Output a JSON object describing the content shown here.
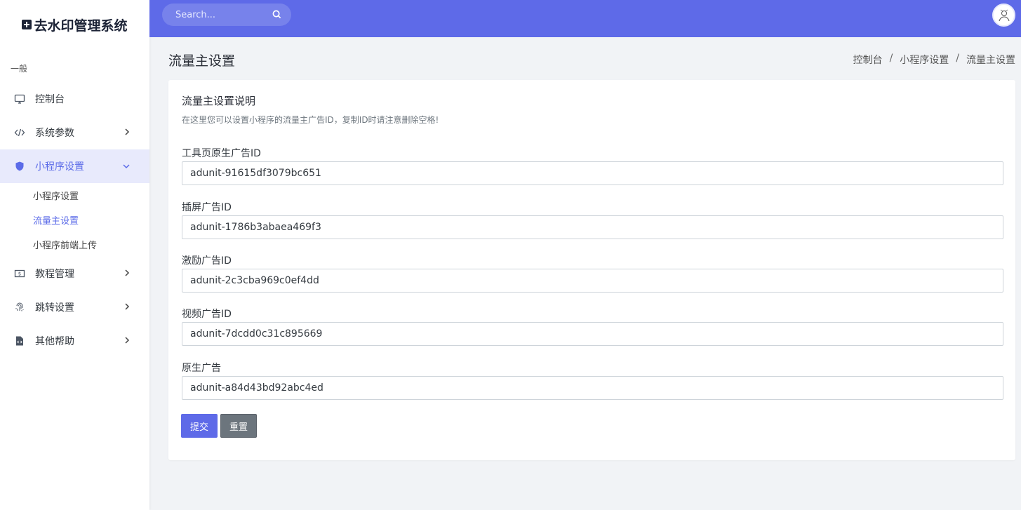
{
  "app": {
    "logo_text": "去水印管理系统"
  },
  "sidebar": {
    "section_title": "一般",
    "items": [
      {
        "label": "控制台",
        "icon": "monitor-icon"
      },
      {
        "label": "系统参数",
        "icon": "code-icon"
      },
      {
        "label": "小程序设置",
        "icon": "shield-icon"
      },
      {
        "label": "教程管理",
        "icon": "dollar-bill-icon"
      },
      {
        "label": "跳转设置",
        "icon": "fingerprint-icon"
      },
      {
        "label": "其他帮助",
        "icon": "file-code-icon"
      }
    ],
    "subitems": [
      {
        "label": "小程序设置"
      },
      {
        "label": "流量主设置"
      },
      {
        "label": "小程序前端上传"
      }
    ]
  },
  "topbar": {
    "search_placeholder": "Search..."
  },
  "page": {
    "title": "流量主设置",
    "breadcrumb": [
      "控制台",
      "小程序设置",
      "流量主设置"
    ]
  },
  "card": {
    "title": "流量主设置说明",
    "description": "在这里您可以设置小程序的流量主广告ID，复制ID时请注意删除空格!",
    "fields": [
      {
        "label": "工具页原生广告ID",
        "value": "adunit-91615df3079bc651"
      },
      {
        "label": "插屏广告ID",
        "value": "adunit-1786b3abaea469f3"
      },
      {
        "label": "激励广告ID",
        "value": "adunit-2c3cba969c0ef4dd"
      },
      {
        "label": "视频广告ID",
        "value": "adunit-7dcdd0c31c895669"
      },
      {
        "label": "原生广告",
        "value": "adunit-a84d43bd92abc4ed"
      }
    ],
    "submit_label": "提交",
    "reset_label": "重置"
  },
  "colors": {
    "accent": "#5e6ae8",
    "active_bg": "#e8eafc",
    "background": "#f1f3f6"
  }
}
